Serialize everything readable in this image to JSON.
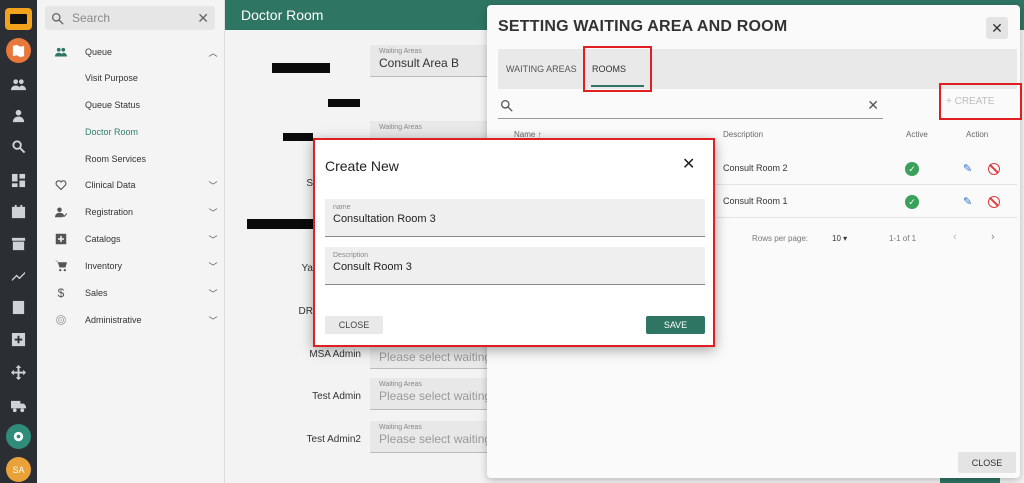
{
  "nav": {
    "search_placeholder": "Search",
    "items": [
      {
        "label": "Queue",
        "icon": "people-icon",
        "expanded": true
      },
      {
        "label": "Clinical Data",
        "icon": "heart-icon"
      },
      {
        "label": "Registration",
        "icon": "person-check-icon"
      },
      {
        "label": "Catalogs",
        "icon": "plus-box-icon"
      },
      {
        "label": "Inventory",
        "icon": "cart-icon"
      },
      {
        "label": "Sales",
        "icon": "dollar-icon"
      },
      {
        "label": "Administrative",
        "icon": "fingerprint-icon"
      }
    ],
    "queue_children": [
      "Visit Purpose",
      "Queue Status",
      "Doctor Room",
      "Room Services"
    ],
    "active_child": "Doctor Room"
  },
  "main": {
    "title": "Doctor Room",
    "fields": [
      {
        "small_label": "Waiting Areas",
        "value": "Consult Area B"
      },
      {
        "small_label": "Waiting Areas",
        "value": ""
      },
      {
        "label": "MSA Admin",
        "small_label": "",
        "value": "Please select waiting a"
      },
      {
        "label": "Test Admin",
        "small_label": "Waiting Areas",
        "value": "Please select waiting a"
      },
      {
        "label": "Test Admin2",
        "small_label": "Waiting Areas",
        "value": "Please select waiting a"
      }
    ],
    "partial_labels": [
      "S",
      "Ya",
      "DR"
    ]
  },
  "settings": {
    "title": "SETTING WAITING AREA AND ROOM",
    "tabs": [
      "WAITING AREAS",
      "ROOMS"
    ],
    "active_tab": "ROOMS",
    "create_label": "+ CREATE",
    "columns": {
      "name": "Name ↑",
      "description": "Description",
      "active": "Active",
      "action": "Action"
    },
    "rows": [
      {
        "description": "Consult Room 2",
        "active": true
      },
      {
        "description": "Consult Room 1",
        "active": true
      }
    ],
    "pagination": {
      "rows_per_page_label": "Rows per page:",
      "rows_per_page": "10",
      "range": "1-1 of 1"
    },
    "close_label": "CLOSE"
  },
  "modal": {
    "title": "Create New",
    "name_label": "name",
    "name_value": "Consultation Room 3",
    "description_label": "Description",
    "description_value": "Consult Room 3",
    "close_label": "CLOSE",
    "save_label": "SAVE"
  },
  "colors": {
    "brand": "#2f7564",
    "highlight": "#e02020",
    "accent_orange": "#e8773a"
  }
}
